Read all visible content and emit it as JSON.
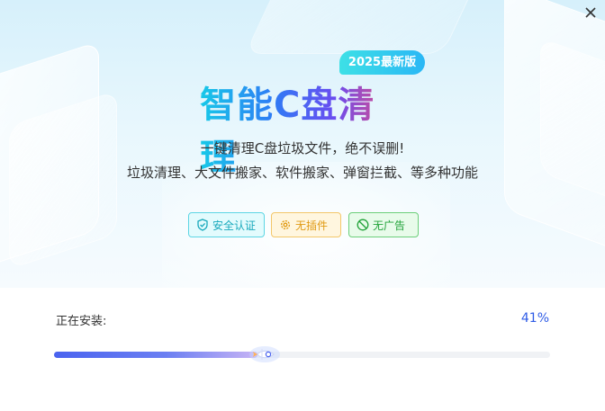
{
  "window": {
    "close_label": "×"
  },
  "hero": {
    "year_badge": "2025最新版",
    "title": "智能C盘清理",
    "tagline_1": "一键清理C盘垃圾文件，绝不误删!",
    "tagline_2": "垃圾清理、大文件搬家、软件搬家、弹窗拦截、等多种功能"
  },
  "badges": [
    {
      "label": "安全认证",
      "icon": "shield-check-icon",
      "color": "#18a9bc"
    },
    {
      "label": "无插件",
      "icon": "gear-icon",
      "color": "#e09a13"
    },
    {
      "label": "无广告",
      "icon": "no-ad-icon",
      "color": "#22a33a"
    }
  ],
  "install": {
    "label": "正在安装:",
    "percent_text": "41%",
    "progress": 0.41
  },
  "colors": {
    "accent": "#2f5ce6",
    "progress_start": "#4a63ef",
    "progress_end": "#c7b4f5"
  }
}
